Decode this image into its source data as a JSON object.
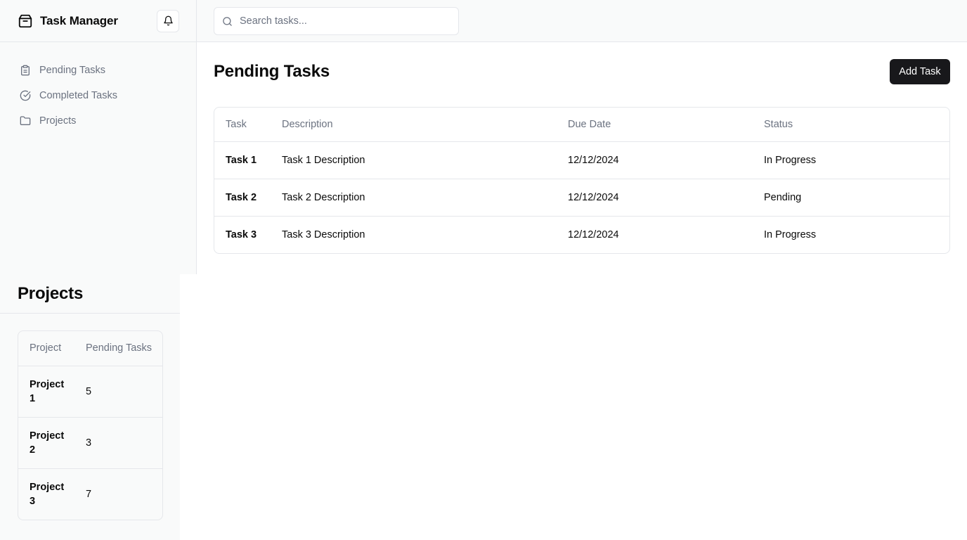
{
  "sidebar": {
    "brand": {
      "title": "Task Manager",
      "icon": "package-icon"
    },
    "notifications_icon": "bell-icon",
    "items": [
      {
        "label": "Pending Tasks",
        "icon": "clipboard-icon"
      },
      {
        "label": "Completed Tasks",
        "icon": "check-circle-icon"
      },
      {
        "label": "Projects",
        "icon": "folder-icon"
      }
    ]
  },
  "search": {
    "placeholder": "Search tasks...",
    "value": "",
    "icon": "search-icon"
  },
  "main": {
    "title": "Pending Tasks",
    "add_button": "Add Task",
    "table": {
      "columns": [
        "Task",
        "Description",
        "Due Date",
        "Status"
      ],
      "rows": [
        {
          "task": "Task 1",
          "description": "Task 1 Description",
          "due_date": "12/12/2024",
          "status": "In Progress"
        },
        {
          "task": "Task 2",
          "description": "Task 2 Description",
          "due_date": "12/12/2024",
          "status": "Pending"
        },
        {
          "task": "Task 3",
          "description": "Task 3 Description",
          "due_date": "12/12/2024",
          "status": "In Progress"
        }
      ]
    }
  },
  "projects": {
    "title": "Projects",
    "columns": [
      "Project",
      "Pending Tasks"
    ],
    "rows": [
      {
        "project": "Project 1",
        "pending": "5"
      },
      {
        "project": "Project 2",
        "pending": "3"
      },
      {
        "project": "Project 3",
        "pending": "7"
      }
    ]
  },
  "colors": {
    "accent": "#18181b",
    "muted_text": "#6b7280",
    "border": "#e5e7eb",
    "panel_bg": "#f9fafa"
  }
}
